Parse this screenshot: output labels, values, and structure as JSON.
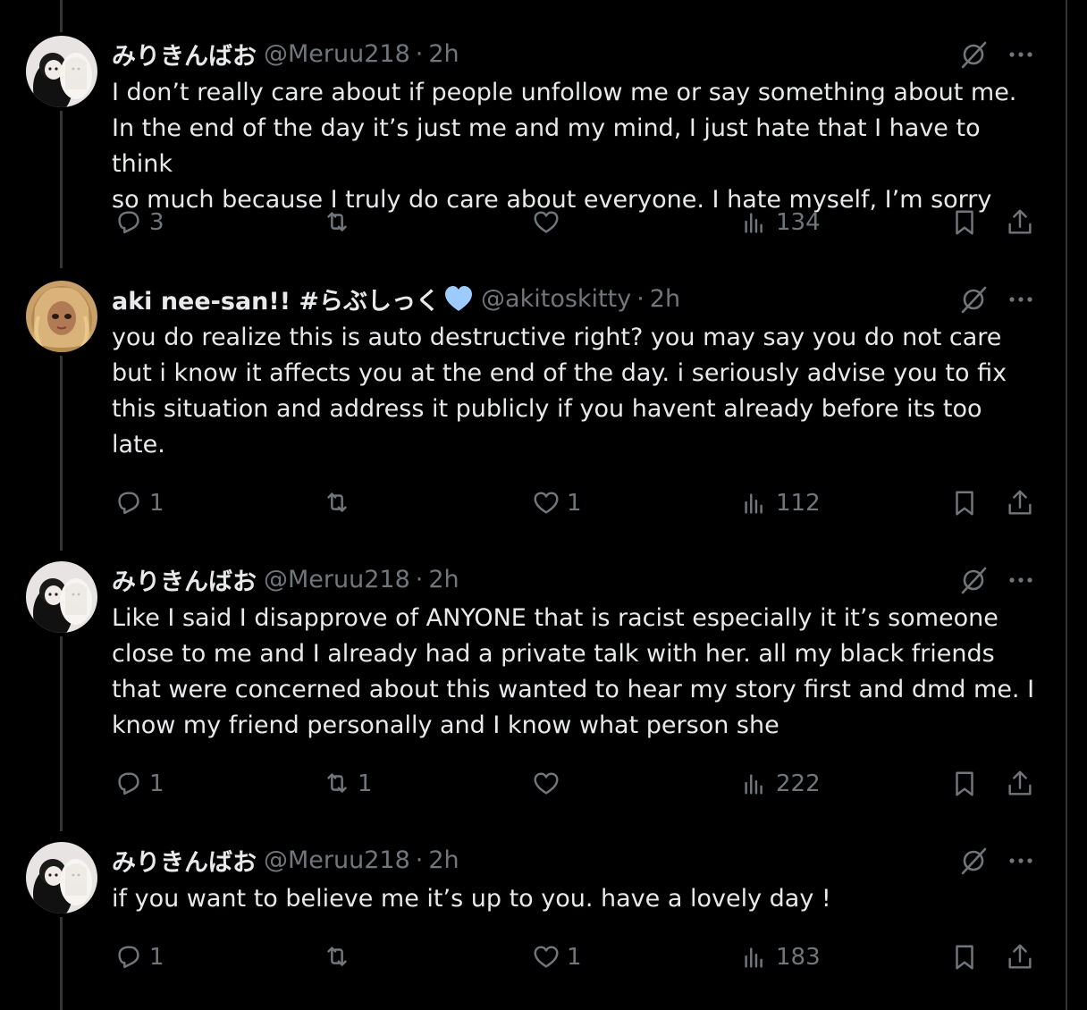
{
  "tweets": [
    {
      "name": "みりきんばお",
      "handle": "@Meruu218",
      "time": "2h",
      "text": "I don’t really care about if people unfollow me or say something about me.\nIn the end of the day it’s just me and my mind, I just hate that I have to think\nso much because I truly do care about everyone. I hate myself, I’m sorry",
      "replies": "3",
      "reposts": "",
      "likes": "",
      "views": "134"
    },
    {
      "name": "aki nee-san!! #らぶしっく",
      "handle": "@akitoskitty",
      "time": "2h",
      "text": "you do realize this is auto destructive right? you may say you do not care\nbut i know it affects you at the end of the day. i seriously advise you to fix\nthis situation and address it publicly if you havent already before its too\nlate.",
      "replies": "1",
      "reposts": "",
      "likes": "1",
      "views": "112"
    },
    {
      "name": "みりきんばお",
      "handle": "@Meruu218",
      "time": "2h",
      "text": "Like I said I disapprove of ANYONE that is racist especially it it’s someone\nclose to me and I already had a private talk with her. all my black friends\nthat were concerned about this wanted to hear my story first and dmd me. I\nknow my friend personally and I know what person she",
      "replies": "1",
      "reposts": "1",
      "likes": "",
      "views": "222"
    },
    {
      "name": "みりきんばお",
      "handle": "@Meruu218",
      "time": "2h",
      "text": "if you want to believe me it’s up to you. have a lovely day !",
      "replies": "1",
      "reposts": "",
      "likes": "1",
      "views": "183"
    }
  ],
  "separator": "·",
  "colors": {
    "background": "#000000",
    "text": "#e7e9ea",
    "muted": "#71767b",
    "heart_emoji": "#9ecbff"
  }
}
